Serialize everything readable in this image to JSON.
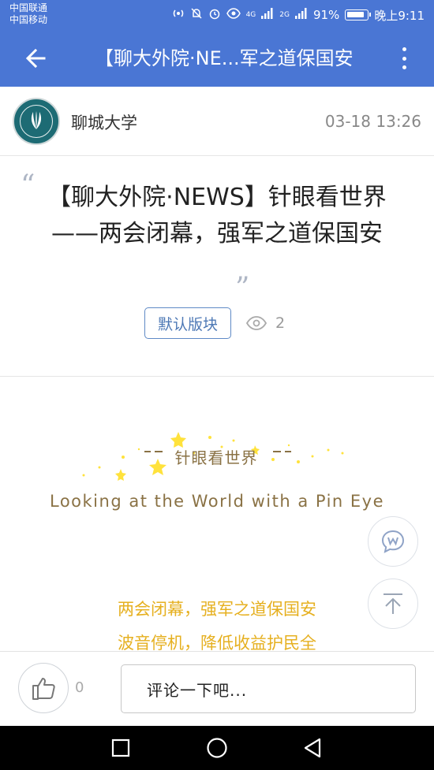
{
  "status_bar": {
    "carrier_1": "中国联通",
    "carrier_2": "中国移动",
    "network_1": "4G",
    "network_2": "2G",
    "battery": "91%",
    "time": "晚上9:11",
    "icons": [
      "hotspot-icon",
      "mute-icon",
      "alarm-icon",
      "eye-icon",
      "signal-icon",
      "battery-icon"
    ]
  },
  "app_bar": {
    "title": "【聊大外院·NE...军之道保国安",
    "back_icon": "arrow-left-icon",
    "more_icon": "more-vertical-icon",
    "color": "#4a76d4"
  },
  "author": {
    "name": "聊城大学",
    "time": "03-18 13:26",
    "avatar_icon": "university-logo"
  },
  "article": {
    "title": "【聊大外院·NEWS】针眼看世界——两会闭幕，强军之道保国安",
    "tag": "默认版块",
    "views": "2"
  },
  "body": {
    "banner_cn": "针眼看世界",
    "banner_en": "Looking at the World with a Pin Eye",
    "lines": [
      "两会闭幕，强军之道保国安",
      "波音停机，降低收益护民全"
    ]
  },
  "footer": {
    "likes": "0",
    "comment_placeholder": "评论一下吧..."
  },
  "colors": {
    "accent": "#4a76d4",
    "gold_text": "#8a7245",
    "highlight_text": "#e6b020"
  }
}
